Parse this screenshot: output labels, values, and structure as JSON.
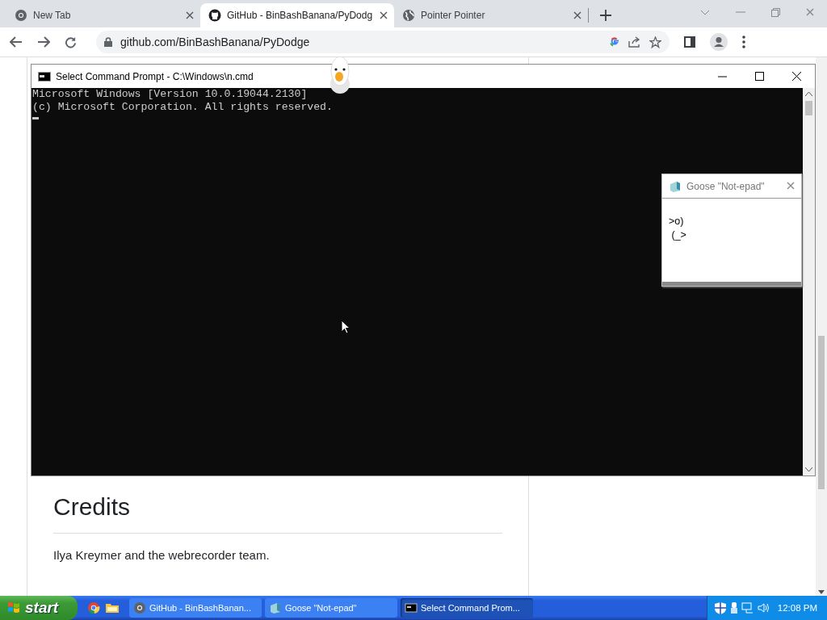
{
  "browser": {
    "tabs": [
      {
        "title": "New Tab",
        "selected": false
      },
      {
        "title": "GitHub - BinBashBanana/PyDodg",
        "selected": true
      },
      {
        "title": "Pointer Pointer",
        "selected": false
      }
    ],
    "url": "github.com/BinBashBanana/PyDodge"
  },
  "page": {
    "heading": "Credits",
    "paragraph": "Ilya Kreymer and the webrecorder team."
  },
  "cmd_window": {
    "title": "Select Command Prompt - C:\\Windows\\n.cmd",
    "lines": [
      "Microsoft Windows [Version 10.0.19044.2130]",
      "(c) Microsoft Corporation. All rights reserved."
    ]
  },
  "notepad": {
    "title": "Goose \"Not-epad\"",
    "lines": [
      ">o)",
      " (_>"
    ]
  },
  "taskbar": {
    "start": "start",
    "tasks": [
      {
        "label": "GitHub - BinBashBanan...",
        "selected": false
      },
      {
        "label": "Goose \"Not-epad\"",
        "selected": false
      },
      {
        "label": "Select Command Prom...",
        "selected": true
      }
    ],
    "clock": "12:08 PM"
  }
}
